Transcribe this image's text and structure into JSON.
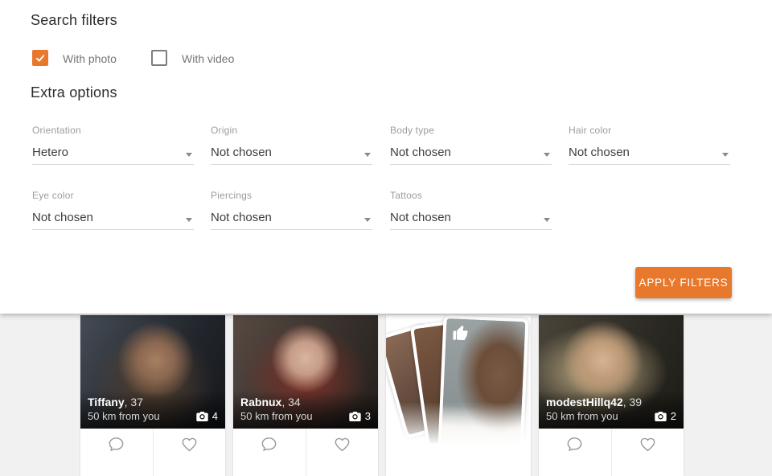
{
  "accent_color": "#e8782c",
  "icons": {
    "checkbox_check": "checkmark",
    "select_caret": "chevron-down triangle",
    "camera": "filled camera with lens",
    "chat": "speech-bubble outline",
    "heart": "heart outline",
    "thumbs_up": "white thumbs-up"
  },
  "filters": {
    "title": "Search filters",
    "with_photo": {
      "label": "With photo",
      "checked": true
    },
    "with_video": {
      "label": "With video",
      "checked": false
    },
    "extra_title": "Extra options",
    "selects": [
      {
        "label": "Orientation",
        "value": "Hetero"
      },
      {
        "label": "Origin",
        "value": "Not chosen"
      },
      {
        "label": "Body type",
        "value": "Not chosen"
      },
      {
        "label": "Hair color",
        "value": "Not chosen"
      },
      {
        "label": "Eye color",
        "value": "Not chosen"
      },
      {
        "label": "Piercings",
        "value": "Not chosen"
      },
      {
        "label": "Tattoos",
        "value": "Not chosen"
      }
    ],
    "apply_button": "APPLY FILTERS"
  },
  "results": {
    "cards": [
      {
        "name": "Tiffany",
        "age": "37",
        "distance": "50 km from you",
        "photo_count": "4"
      },
      {
        "name": "Rabnux",
        "age": "34",
        "distance": "50 km from you",
        "photo_count": "3"
      },
      {
        "promo": true
      },
      {
        "name": "modestHillq42",
        "age": "39",
        "distance": "50 km from you",
        "photo_count": "2"
      }
    ]
  }
}
